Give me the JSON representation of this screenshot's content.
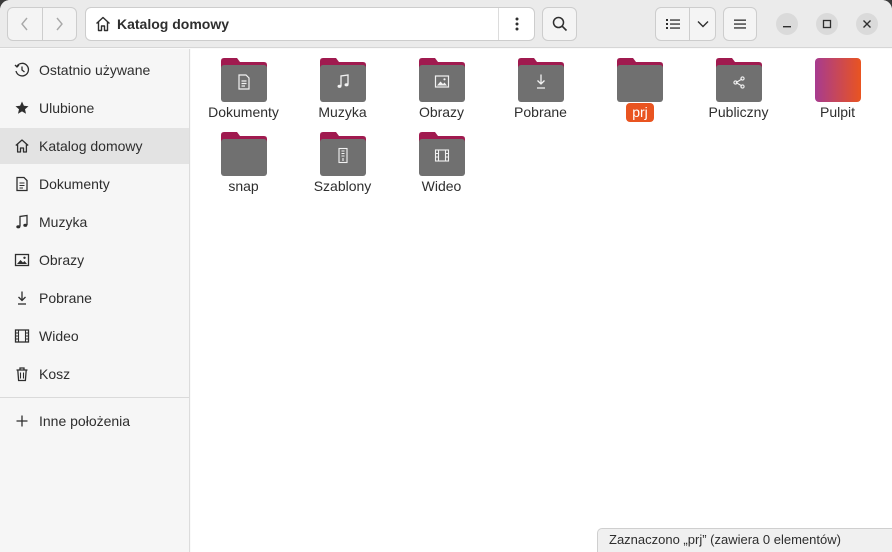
{
  "window": {
    "path_title": "Katalog domowy"
  },
  "icons": {
    "back": "chevron-left-icon",
    "forward": "chevron-right-icon",
    "home": "home-icon",
    "path_menu": "vertical-dots-icon",
    "search": "search-icon",
    "view": "list-view-icon",
    "view_dropdown": "chevron-down-icon",
    "menu": "hamburger-icon",
    "minimize": "minimize-icon",
    "maximize": "maximize-icon",
    "close": "close-icon"
  },
  "sidebar": {
    "items": [
      {
        "label": "Ostatnio używane",
        "icon": "clock-icon"
      },
      {
        "label": "Ulubione",
        "icon": "star-icon"
      },
      {
        "label": "Katalog domowy",
        "icon": "home-icon",
        "active": true
      },
      {
        "label": "Dokumenty",
        "icon": "document-icon"
      },
      {
        "label": "Muzyka",
        "icon": "music-icon"
      },
      {
        "label": "Obrazy",
        "icon": "image-icon"
      },
      {
        "label": "Pobrane",
        "icon": "download-icon"
      },
      {
        "label": "Wideo",
        "icon": "video-icon"
      },
      {
        "label": "Kosz",
        "icon": "trash-icon"
      }
    ],
    "other_locations": {
      "label": "Inne położenia",
      "icon": "plus-icon"
    }
  },
  "files": [
    {
      "name": "Dokumenty",
      "emblem": "document"
    },
    {
      "name": "Muzyka",
      "emblem": "music"
    },
    {
      "name": "Obrazy",
      "emblem": "image"
    },
    {
      "name": "Pobrane",
      "emblem": "download"
    },
    {
      "name": "prj",
      "emblem": "none",
      "selected": true
    },
    {
      "name": "Publiczny",
      "emblem": "share"
    },
    {
      "name": "Pulpit",
      "emblem": "desktop"
    },
    {
      "name": "snap",
      "emblem": "none"
    },
    {
      "name": "Szablony",
      "emblem": "template"
    },
    {
      "name": "Wideo",
      "emblem": "video"
    }
  ],
  "status": "Zaznaczono „prj”  (zawiera 0 elementów)",
  "colors": {
    "accent": "#e95420",
    "folder_body": "#6f6f6f",
    "folder_tab": "#a01a4f",
    "desktop_gradient_start": "#a73b8f",
    "desktop_gradient_end": "#e95420"
  }
}
